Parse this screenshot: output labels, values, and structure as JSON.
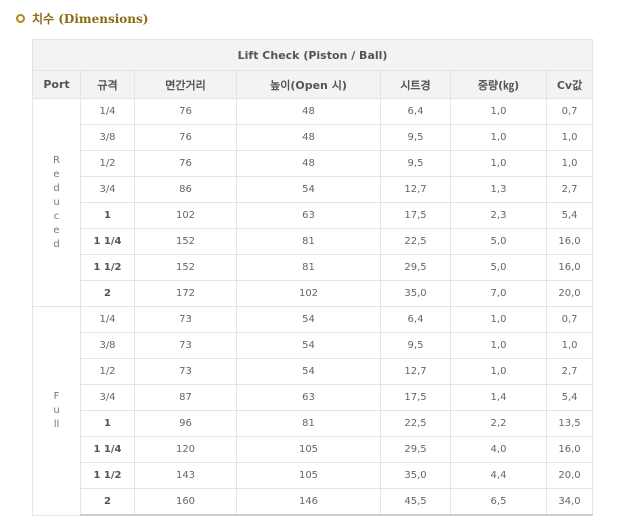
{
  "section": {
    "title": "치수 (Dimensions)"
  },
  "table": {
    "caption": "Lift Check (Piston / Ball)",
    "headers": [
      "Port",
      "규격",
      "면간거리",
      "높이(Open 시)",
      "시트경",
      "중량(㎏)",
      "Cv값"
    ],
    "groups": [
      {
        "port": "Reduced",
        "rows": [
          {
            "size": "1/4",
            "bold": false,
            "cells": [
              "76",
              "48",
              "6,4",
              "1,0",
              "0,7"
            ]
          },
          {
            "size": "3/8",
            "bold": false,
            "cells": [
              "76",
              "48",
              "9,5",
              "1,0",
              "1,0"
            ]
          },
          {
            "size": "1/2",
            "bold": false,
            "cells": [
              "76",
              "48",
              "9,5",
              "1,0",
              "1,0"
            ]
          },
          {
            "size": "3/4",
            "bold": false,
            "cells": [
              "86",
              "54",
              "12,7",
              "1,3",
              "2,7"
            ]
          },
          {
            "size": "1",
            "bold": true,
            "cells": [
              "102",
              "63",
              "17,5",
              "2,3",
              "5,4"
            ]
          },
          {
            "size": "1 1/4",
            "bold": true,
            "cells": [
              "152",
              "81",
              "22,5",
              "5,0",
              "16,0"
            ]
          },
          {
            "size": "1 1/2",
            "bold": true,
            "cells": [
              "152",
              "81",
              "29,5",
              "5,0",
              "16,0"
            ]
          },
          {
            "size": "2",
            "bold": true,
            "cells": [
              "172",
              "102",
              "35,0",
              "7,0",
              "20,0"
            ]
          }
        ]
      },
      {
        "port": "Full",
        "rows": [
          {
            "size": "1/4",
            "bold": false,
            "cells": [
              "73",
              "54",
              "6,4",
              "1,0",
              "0,7"
            ]
          },
          {
            "size": "3/8",
            "bold": false,
            "cells": [
              "73",
              "54",
              "9,5",
              "1,0",
              "1,0"
            ]
          },
          {
            "size": "1/2",
            "bold": false,
            "cells": [
              "73",
              "54",
              "12,7",
              "1,0",
              "2,7"
            ]
          },
          {
            "size": "3/4",
            "bold": false,
            "cells": [
              "87",
              "63",
              "17,5",
              "1,4",
              "5,4"
            ]
          },
          {
            "size": "1",
            "bold": true,
            "cells": [
              "96",
              "81",
              "22,5",
              "2,2",
              "13,5"
            ]
          },
          {
            "size": "1 1/4",
            "bold": true,
            "cells": [
              "120",
              "105",
              "29,5",
              "4,0",
              "16,0"
            ]
          },
          {
            "size": "1 1/2",
            "bold": true,
            "cells": [
              "143",
              "105",
              "35,0",
              "4,4",
              "20,0"
            ]
          },
          {
            "size": "2",
            "bold": true,
            "cells": [
              "160",
              "146",
              "45,5",
              "6,5",
              "34,0"
            ]
          }
        ]
      }
    ]
  },
  "colors": {
    "title": "#8a6a12",
    "bullet": "#b08a1a",
    "header_bg": "#f3f3f3",
    "border": "#e4e4e4",
    "text": "#666666"
  },
  "icons": {
    "bullet": "circle-bullet-icon"
  }
}
